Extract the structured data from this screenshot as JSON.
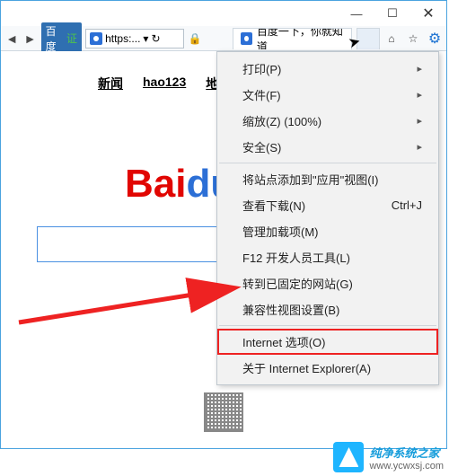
{
  "window": {
    "minimize": "—",
    "maximize": "☐",
    "close": "✕"
  },
  "toolbar": {
    "back": "◄",
    "fwd": "►",
    "site_badge": "百度",
    "site_badge_hint": "证",
    "url": "https:...",
    "dropdown": "▾",
    "refresh": "↻",
    "lock": "🔒",
    "home": "⌂",
    "star": "☆",
    "gear": "⚙"
  },
  "tab": {
    "title": "百度一下，你就知道"
  },
  "page_nav": {
    "news": "新闻",
    "hao123": "hao123",
    "map": "地图"
  },
  "menu": {
    "items": [
      {
        "label": "打印(P)",
        "sub": true
      },
      {
        "label": "文件(F)",
        "sub": true
      },
      {
        "label": "缩放(Z) (100%)",
        "sub": true
      },
      {
        "label": "安全(S)",
        "sub": true
      }
    ],
    "items2": [
      {
        "label": "将站点添加到\"应用\"视图(I)"
      },
      {
        "label": "查看下载(N)",
        "shortcut": "Ctrl+J"
      },
      {
        "label": "管理加载项(M)"
      },
      {
        "label": "F12 开发人员工具(L)"
      },
      {
        "label": "转到已固定的网站(G)"
      },
      {
        "label": "兼容性视图设置(B)"
      }
    ],
    "items3": [
      {
        "label": "Internet 选项(O)",
        "highlight": true
      },
      {
        "label": "关于 Internet Explorer(A)"
      }
    ]
  },
  "watermark": {
    "title": "纯净系统之家",
    "url": "www.ycwxsj.com"
  }
}
